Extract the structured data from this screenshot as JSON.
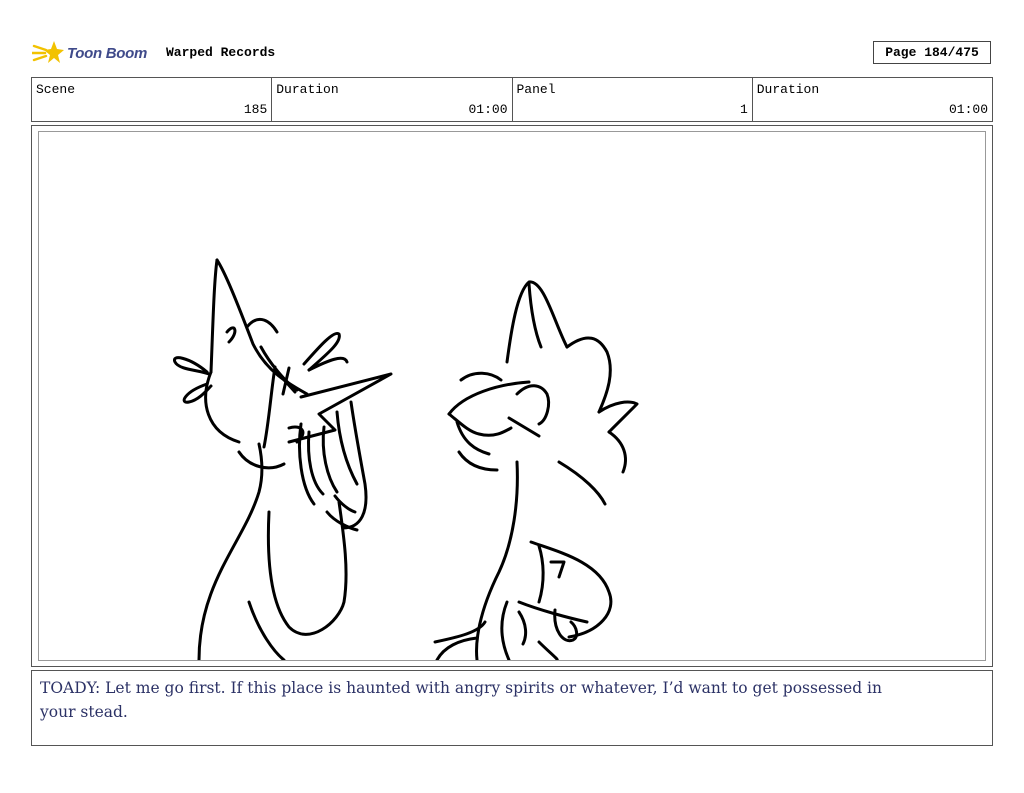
{
  "header": {
    "logo_text": "Toon Boom",
    "project_title": "Warped Records",
    "page_label": "Page 184/475"
  },
  "info": {
    "scene_label": "Scene",
    "scene_value": "185",
    "scene_duration_label": "Duration",
    "scene_duration_value": "01:00",
    "panel_label": "Panel",
    "panel_value": "1",
    "panel_duration_label": "Duration",
    "panel_duration_value": "01:00"
  },
  "panel": {
    "image_description": "storyboard sketch"
  },
  "dialogue": {
    "text": "TOADY: Let me go first. If this place is haunted with angry spirits or whatever, I’d want to get possessed in your stead."
  },
  "colors": {
    "logo_star": "#f2c200",
    "logo_text": "#3f4a8a",
    "dialogue_text": "#2c3266",
    "border": "#555555"
  }
}
